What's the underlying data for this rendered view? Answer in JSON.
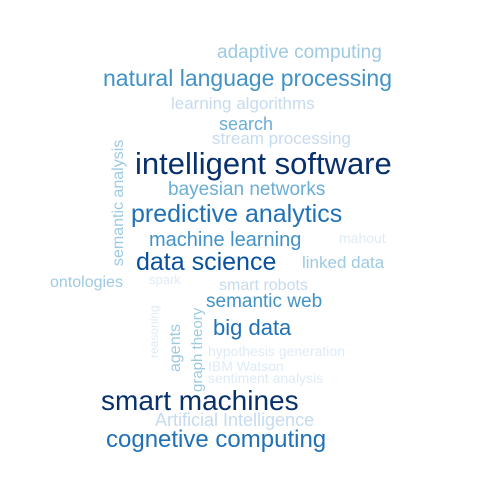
{
  "word_cloud": {
    "words": [
      {
        "text": "adaptive computing",
        "color": "#9ecae1"
      },
      {
        "text": "natural language processing",
        "color": "#4292c6"
      },
      {
        "text": "learning algorithms",
        "color": "#c6dbef"
      },
      {
        "text": "search",
        "color": "#6baed6"
      },
      {
        "text": "stream processing",
        "color": "#c6dbef"
      },
      {
        "text": "semantic analysis",
        "color": "#9ecae1"
      },
      {
        "text": "intelligent software",
        "color": "#08306b"
      },
      {
        "text": "bayesian networks",
        "color": "#6baed6"
      },
      {
        "text": "predictive analytics",
        "color": "#2171b5"
      },
      {
        "text": "machine learning",
        "color": "#4292c6"
      },
      {
        "text": "mahout",
        "color": "#deebf7"
      },
      {
        "text": "data science",
        "color": "#08519c"
      },
      {
        "text": "linked data",
        "color": "#9ecae1"
      },
      {
        "text": "ontologies",
        "color": "#9ecae1"
      },
      {
        "text": "spark",
        "color": "#deebf7"
      },
      {
        "text": "smart robots",
        "color": "#c6dbef"
      },
      {
        "text": "semantic web",
        "color": "#4292c6"
      },
      {
        "text": "reasoning",
        "color": "#deebf7"
      },
      {
        "text": "agents",
        "color": "#9ecae1"
      },
      {
        "text": "graph theory",
        "color": "#9ecae1"
      },
      {
        "text": "big data",
        "color": "#2171b5"
      },
      {
        "text": "hypothesis generation",
        "color": "#deebf7"
      },
      {
        "text": "IBM Watson",
        "color": "#deebf7"
      },
      {
        "text": "sentiment analysis",
        "color": "#deebf7"
      },
      {
        "text": "smart machines",
        "color": "#08306b"
      },
      {
        "text": "Artificial Intelligence",
        "color": "#c6dbef"
      },
      {
        "text": "cognetive computing",
        "color": "#2171b5"
      }
    ]
  }
}
